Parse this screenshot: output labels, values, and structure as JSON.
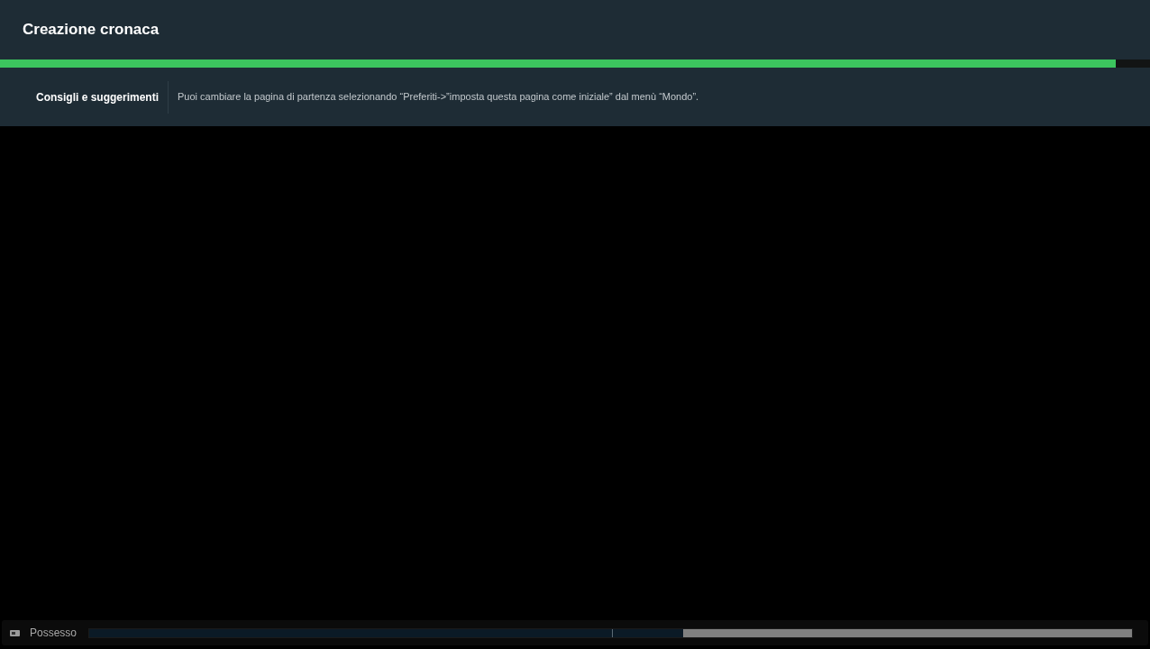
{
  "header": {
    "title": "Creazione cronaca"
  },
  "loading_bar": {
    "level": 0.97
  },
  "tips": {
    "label": "Consigli e suggerimenti",
    "text": "Puoi cambiare la pagina di partenza selezionando “Preferiti->”imposta questa pagina come iniziale” dal menù “Mondo”."
  },
  "status_bar": {
    "label": "Possesso",
    "possession_bar": {
      "level": 0.57
    }
  }
}
